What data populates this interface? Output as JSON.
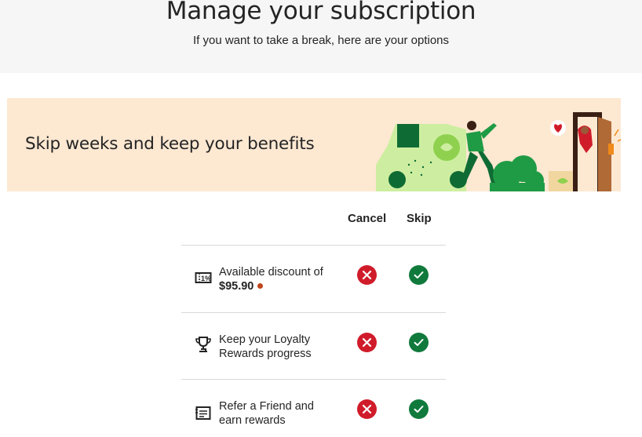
{
  "header": {
    "title": "Manage your subscription",
    "subtitle": "If you want to take a break, here are your options"
  },
  "banner": {
    "heading": "Skip weeks and keep your benefits",
    "illustration": "delivery-van-courier-door-illustration"
  },
  "comparison": {
    "columns": {
      "cancel": "Cancel",
      "skip": "Skip"
    },
    "rows": [
      {
        "icon": "discount-coupon-icon",
        "line1": "Available discount of",
        "amount": "$95.90",
        "cancel": false,
        "skip": true
      },
      {
        "icon": "trophy-icon",
        "line1": "Keep your Loyalty",
        "line2": "Rewards progress",
        "cancel": false,
        "skip": true
      },
      {
        "icon": "referral-card-icon",
        "line1": "Refer a Friend and",
        "line2": "earn rewards",
        "cancel": false,
        "skip": true
      }
    ]
  },
  "colors": {
    "header_bg": "#f6f6f6",
    "banner_bg": "#fde8d2",
    "cancel_mark": "#d01c2a",
    "skip_mark": "#107a3c",
    "alert_dot": "#c0451b"
  }
}
